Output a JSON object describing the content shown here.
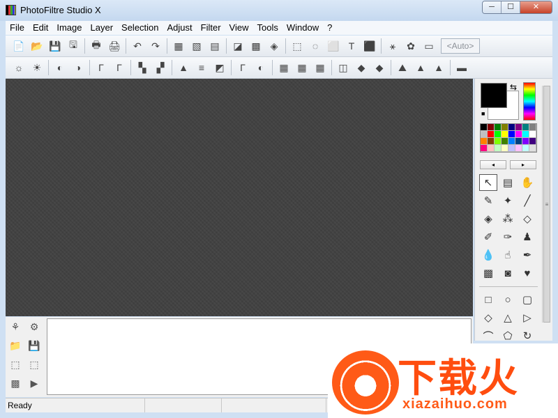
{
  "window": {
    "title": "PhotoFiltre Studio X",
    "controls": {
      "minimize": "─",
      "maximize": "☐",
      "close": "✕"
    }
  },
  "menubar": {
    "items": [
      "File",
      "Edit",
      "Image",
      "Layer",
      "Selection",
      "Adjust",
      "Filter",
      "View",
      "Tools",
      "Window",
      "?"
    ]
  },
  "toolbar1": {
    "icons": [
      "new-file-icon",
      "open-folder-icon",
      "save-icon",
      "save-as-icon",
      "sep",
      "print-icon",
      "scan-icon",
      "sep",
      "undo-icon",
      "redo-icon",
      "sep",
      "image-size-icon",
      "canvas-size-icon",
      "duplicate-icon",
      "sep",
      "gradient-icon",
      "pattern-icon",
      "color-mode-icon",
      "sep",
      "transform-icon",
      "transparent-icon",
      "selection-icon",
      "text-icon",
      "crop-icon",
      "sep",
      "explorer-icon",
      "plugin-icon",
      "window-icon"
    ],
    "glyphs": [
      "📄",
      "📂",
      "💾",
      "🖫",
      "",
      "🖶",
      "🖨",
      "",
      "↶",
      "↷",
      "",
      "▦",
      "▧",
      "▤",
      "",
      "◪",
      "▩",
      "◈",
      "",
      "⬚",
      "◌",
      "⬜",
      "T",
      "⬛",
      "",
      "⚹",
      "✿",
      "▭"
    ],
    "zoom_label": "<Auto>"
  },
  "toolbar2": {
    "icons": [
      "brightness-minus-icon",
      "brightness-plus-icon",
      "sep",
      "contrast-minus-icon",
      "contrast-plus-icon",
      "sep",
      "gamma-minus-icon",
      "gamma-plus-icon",
      "sep",
      "saturation-minus-icon",
      "saturation-plus-icon",
      "sep",
      "histogram-icon",
      "levels-icon",
      "curves-icon",
      "sep",
      "auto-contrast-icon",
      "auto-levels-icon",
      "sep",
      "pixelate-icon",
      "mosaic-icon",
      "grid-icon",
      "sep",
      "blur-icon",
      "drop-icon",
      "drops-icon",
      "sep",
      "mountain-icon",
      "peak-icon",
      "peaks-icon",
      "sep",
      "frame-icon"
    ],
    "glyphs": [
      "☼",
      "☀",
      "",
      "◐",
      "◑",
      "",
      "Γ",
      "Γ",
      "",
      "▚",
      "▞",
      "",
      "▲",
      "≡",
      "◩",
      "",
      "Γ",
      "◐",
      "",
      "▦",
      "▦",
      "▦",
      "",
      "◫",
      "◆",
      "◆",
      "",
      "⛰",
      "▲",
      "▲",
      "",
      "▬"
    ]
  },
  "colors": {
    "foreground": "#000000",
    "background": "#ffffff",
    "swap_glyph": "⇆",
    "reset_glyph": "■",
    "palette": [
      "#000000",
      "#800000",
      "#008000",
      "#808000",
      "#000080",
      "#800080",
      "#008080",
      "#808080",
      "#c0c0c0",
      "#ff0000",
      "#00ff00",
      "#ffff00",
      "#0000ff",
      "#ff00ff",
      "#00ffff",
      "#ffffff",
      "#ff8000",
      "#804000",
      "#80ff00",
      "#408000",
      "#0080ff",
      "#004080",
      "#8000ff",
      "#400080",
      "#ff0080",
      "#ffc0c0",
      "#c0ffc0",
      "#ffffc0",
      "#c0c0ff",
      "#ffc0ff",
      "#c0ffff",
      "#e0e0e0"
    ],
    "prev_label": "◂",
    "next_label": "▸"
  },
  "tools": [
    {
      "name": "pointer-tool",
      "glyph": "↖"
    },
    {
      "name": "layer-manager-tool",
      "glyph": "▤"
    },
    {
      "name": "hand-tool",
      "glyph": "✋"
    },
    {
      "name": "eyedropper-tool",
      "glyph": "✎"
    },
    {
      "name": "magic-wand-tool",
      "glyph": "✦"
    },
    {
      "name": "line-tool",
      "glyph": "╱"
    },
    {
      "name": "fill-bucket-tool",
      "glyph": "◈"
    },
    {
      "name": "spray-tool",
      "glyph": "⁂"
    },
    {
      "name": "eraser-tool",
      "glyph": "◇"
    },
    {
      "name": "brush-tool",
      "glyph": "✐"
    },
    {
      "name": "advanced-brush-tool",
      "glyph": "✑"
    },
    {
      "name": "stamp-tool",
      "glyph": "♟"
    },
    {
      "name": "blur-tool",
      "glyph": "💧"
    },
    {
      "name": "smudge-tool",
      "glyph": "☝"
    },
    {
      "name": "clone-tool",
      "glyph": "✒"
    },
    {
      "name": "deform-tool",
      "glyph": "▩"
    },
    {
      "name": "portrait-tool",
      "glyph": "◙"
    },
    {
      "name": "red-eye-tool",
      "glyph": "♥"
    }
  ],
  "shapes": [
    {
      "name": "rectangle-select",
      "glyph": "□"
    },
    {
      "name": "ellipse-select",
      "glyph": "○"
    },
    {
      "name": "rounded-rect-select",
      "glyph": "▢"
    },
    {
      "name": "diamond-select",
      "glyph": "◇"
    },
    {
      "name": "triangle-select",
      "glyph": "△"
    },
    {
      "name": "triangle-right-select",
      "glyph": "▷"
    },
    {
      "name": "lasso-select",
      "glyph": "⌒"
    },
    {
      "name": "polygon-lasso-select",
      "glyph": "⬠"
    },
    {
      "name": "rotate-select",
      "glyph": "↻"
    }
  ],
  "bottom_panel": {
    "icons": [
      {
        "name": "explorer-tree-icon",
        "glyph": "⚘"
      },
      {
        "name": "explorer-tree-alt-icon",
        "glyph": "⚙"
      },
      {
        "name": "folder-open-icon",
        "glyph": "📁"
      },
      {
        "name": "save-layer-icon",
        "glyph": "💾"
      },
      {
        "name": "selection-copy-icon",
        "glyph": "⬚"
      },
      {
        "name": "selection-paste-icon",
        "glyph": "⬚"
      },
      {
        "name": "pattern-icon",
        "glyph": "▩"
      },
      {
        "name": "play-icon",
        "glyph": "▶"
      }
    ]
  },
  "statusbar": {
    "status": "Ready"
  },
  "watermark": {
    "cn_text": "下载火",
    "url": "xiazaihuo.com"
  }
}
